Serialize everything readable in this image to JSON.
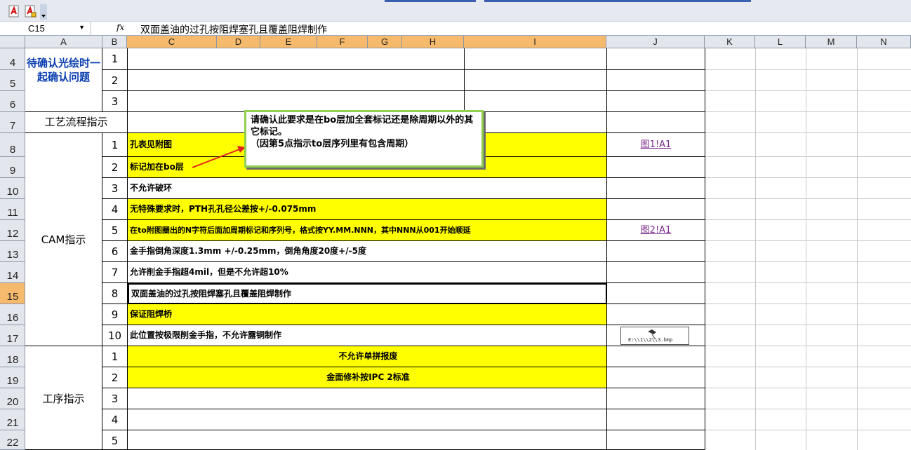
{
  "formula_bar": {
    "name_box": "C15",
    "fx_label": "fx",
    "content": "双面盖油的过孔按阻焊塞孔且覆盖阻焊制作"
  },
  "columns": [
    "A",
    "B",
    "C",
    "D",
    "E",
    "F",
    "G",
    "H",
    "I",
    "J",
    "K",
    "L",
    "M",
    "N"
  ],
  "rows": [
    "4",
    "5",
    "6",
    "7",
    "8",
    "9",
    "10",
    "11",
    "12",
    "13",
    "14",
    "15",
    "16",
    "17",
    "18",
    "19",
    "20",
    "21",
    "22"
  ],
  "sections": {
    "confirm": "待确认光绘时一起确认问题",
    "process": "工艺流程指示",
    "cam": "CAM指示",
    "procedure": "工序指示"
  },
  "confirm_items": [
    "1",
    "2",
    "3"
  ],
  "cam_items": [
    {
      "no": "1",
      "text": "孔表见附图",
      "link": "图1!A1"
    },
    {
      "no": "2",
      "text": "标记加在bo层",
      "link": ""
    },
    {
      "no": "3",
      "text": "不允许破环",
      "link": ""
    },
    {
      "no": "4",
      "text": "无特殊要求时，PTH孔孔径公差按+/-0.075mm",
      "link": ""
    },
    {
      "no": "5",
      "text": "在to附图圈出的N字符后面加周期标记和序列号，格式按YY.MM.NNN，其中NNN从001开始顺延",
      "link": "图2!A1"
    },
    {
      "no": "6",
      "text": "金手指倒角深度1.3mm +/-0.25mm，倒角角度20度+/-5度",
      "link": ""
    },
    {
      "no": "7",
      "text": "允许削金手指超4mil，但是不允许超10%",
      "link": ""
    },
    {
      "no": "8",
      "text": "双面盖油的过孔按阻焊塞孔且覆盖阻焊制作",
      "link": ""
    },
    {
      "no": "9",
      "text": "保证阻焊桥",
      "link": ""
    },
    {
      "no": "10",
      "text": "此位置按极限削金手指，不允许露铜制作",
      "link": ""
    }
  ],
  "procedure_items": [
    {
      "no": "1",
      "text": "不允许单拼报废"
    },
    {
      "no": "2",
      "text": "金面修补按IPC 2标准"
    },
    {
      "no": "3",
      "text": ""
    },
    {
      "no": "4",
      "text": ""
    },
    {
      "no": "5",
      "text": ""
    }
  ],
  "comment": {
    "line1": "请确认此要求是在bo层加全套标记还是除周期以外的其它标记。",
    "line2": "（因第5点指示to层序列里有包含周期）"
  },
  "image_thumb_label": "E:\\\\1\\\\2\\\\3.bmp",
  "colors": {
    "highlight": "#ffff00",
    "selected_header": "#f5ba6c",
    "comment_border": "#8fd14f",
    "arrow": "#e02020"
  }
}
